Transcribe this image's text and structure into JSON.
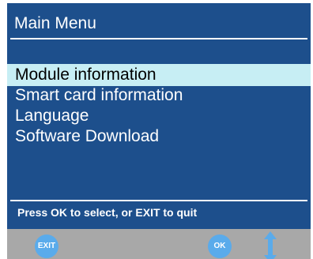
{
  "header": {
    "title": "Main Menu"
  },
  "menu": {
    "items": [
      {
        "label": "Module information",
        "selected": true
      },
      {
        "label": "Smart card information",
        "selected": false
      },
      {
        "label": "Language",
        "selected": false
      },
      {
        "label": "Software Download",
        "selected": false
      }
    ]
  },
  "footer": {
    "hint": "Press OK to select, or EXIT to quit"
  },
  "keys": {
    "exit_label": "EXIT",
    "ok_label": "OK",
    "navigate_icon": "up-down-arrow-icon"
  },
  "colors": {
    "background": "#1d4f8c",
    "selection": "#c7eef4",
    "key_button": "#5aabeb",
    "key_bar": "#a8a8a8"
  }
}
